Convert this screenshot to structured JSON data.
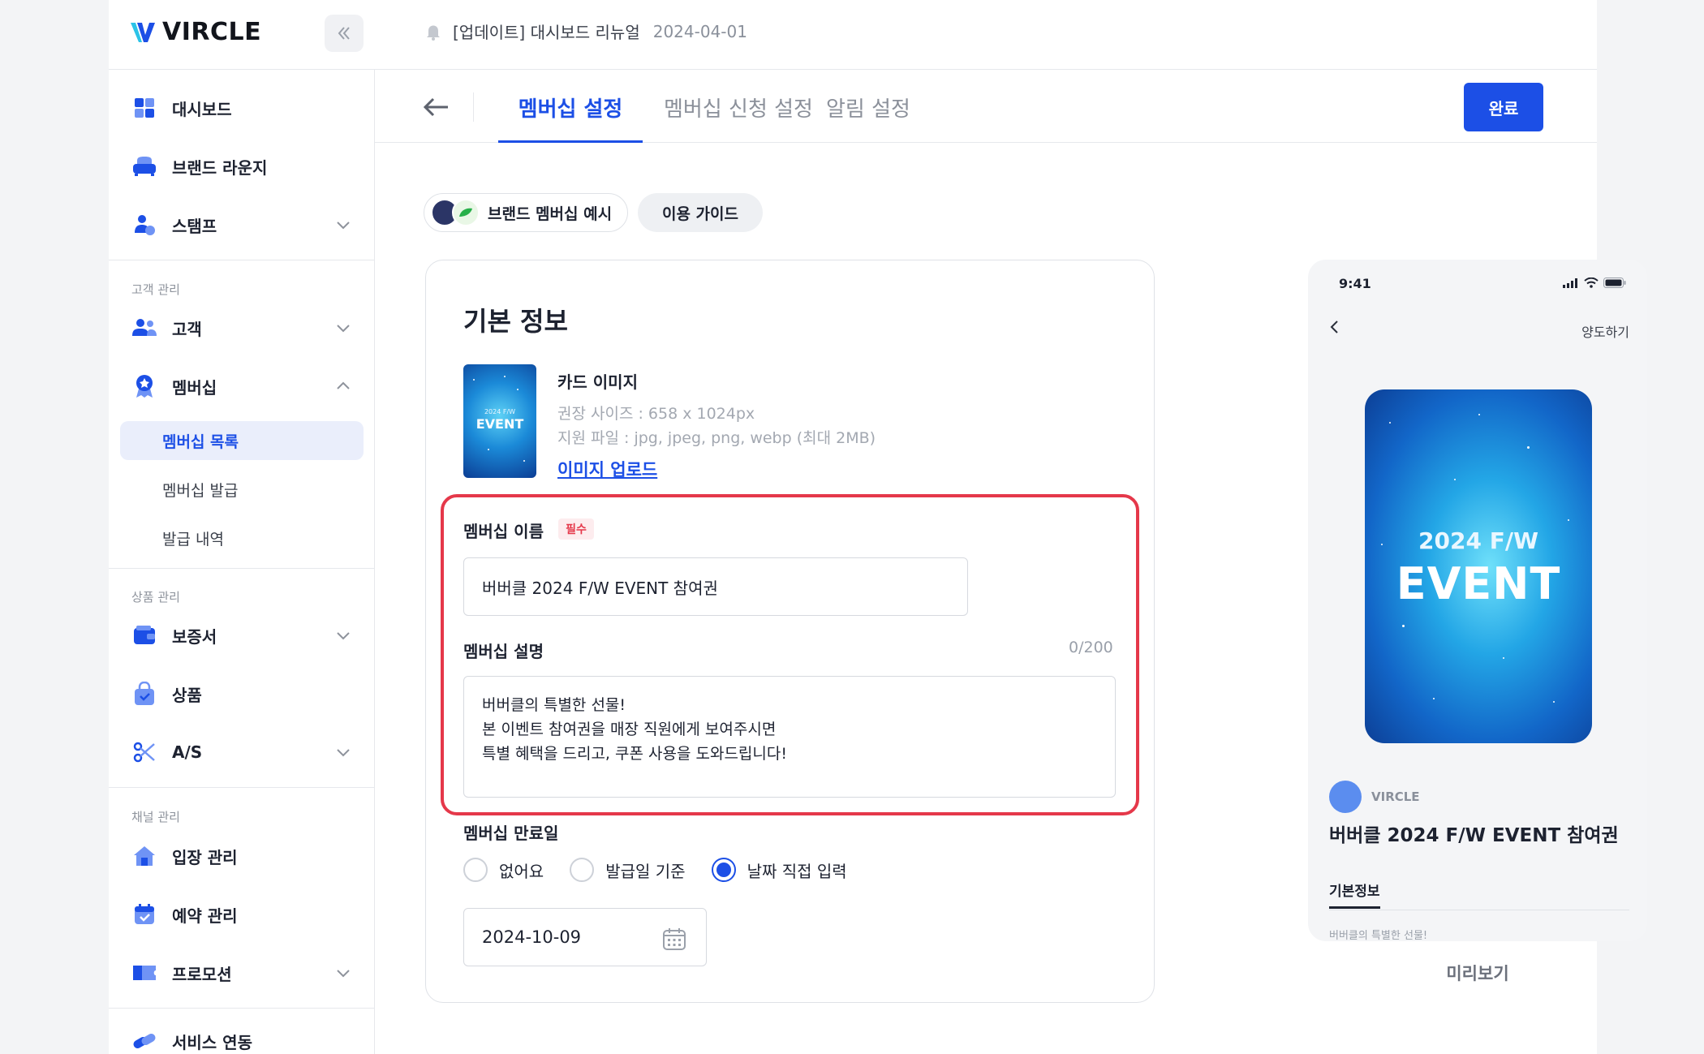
{
  "app": {
    "logo_text": "VIRCLE",
    "notice": {
      "text": "[업데이트] 대시보드 리뉴얼",
      "date": "2024-04-01"
    }
  },
  "sidebar": {
    "top_items": [
      {
        "label": "대시보드"
      },
      {
        "label": "브랜드 라운지"
      },
      {
        "label": "스탬프"
      }
    ],
    "sections": [
      {
        "label": "고객 관리"
      },
      {
        "label": "상품 관리"
      },
      {
        "label": "채널 관리"
      }
    ],
    "customer_items": [
      {
        "label": "고객"
      },
      {
        "label": "멤버십"
      }
    ],
    "membership_sub": [
      {
        "label": "멤버십 목록"
      },
      {
        "label": "멤버십 발급"
      },
      {
        "label": "발급 내역"
      }
    ],
    "product_items": [
      {
        "label": "보증서"
      },
      {
        "label": "상품"
      },
      {
        "label": "A/S"
      }
    ],
    "channel_items": [
      {
        "label": "입장 관리"
      },
      {
        "label": "예약 관리"
      },
      {
        "label": "프로모션"
      },
      {
        "label": "서비스 연동"
      }
    ]
  },
  "header": {
    "tabs": [
      {
        "label": "멤버십 설정"
      },
      {
        "label": "멤버십 신청 설정"
      },
      {
        "label": "알림 설정"
      }
    ],
    "done_label": "완료"
  },
  "actions": {
    "example_label": "브랜드 멤버십 예시",
    "guide_label": "이용 가이드"
  },
  "form": {
    "title": "기본 정보",
    "card_image": {
      "label": "카드 이미지",
      "size_hint": "권장 사이즈 : 658 x 1024px",
      "file_hint": "지원 파일 : jpg, jpeg, png, webp (최대 2MB)",
      "upload_label": "이미지 업로드",
      "thumb_year": "2024 F/W",
      "thumb_title": "EVENT"
    },
    "name": {
      "label": "멤버십 이름",
      "required_badge": "필수",
      "value": "버버클 2024 F/W EVENT 참여권"
    },
    "description": {
      "label": "멤버십 설명",
      "count": "0/200",
      "lines": [
        "버버클의 특별한 선물!",
        "본 이벤트 참여권을 매장 직원에게 보여주시면",
        "특별 혜택을 드리고, 쿠폰 사용을 도와드립니다!"
      ]
    },
    "expiry": {
      "label": "멤버십 만료일",
      "options": [
        {
          "label": "없어요",
          "selected": false
        },
        {
          "label": "발급일 기준",
          "selected": false
        },
        {
          "label": "날짜 직접 입력",
          "selected": true
        }
      ],
      "date_value": "2024-10-09"
    }
  },
  "preview": {
    "status_time": "9:41",
    "transfer_label": "양도하기",
    "card_year": "2024 F/W",
    "card_title": "EVENT",
    "brand_name": "VIRCLE",
    "membership_name": "버버클 2024 F/W EVENT 참여권",
    "tab_label": "기본정보",
    "desc_preview": "버버클의 특별한 선물!",
    "label": "미리보기"
  },
  "colors": {
    "accent": "#1c4fe6",
    "highlight": "#e5384a"
  }
}
